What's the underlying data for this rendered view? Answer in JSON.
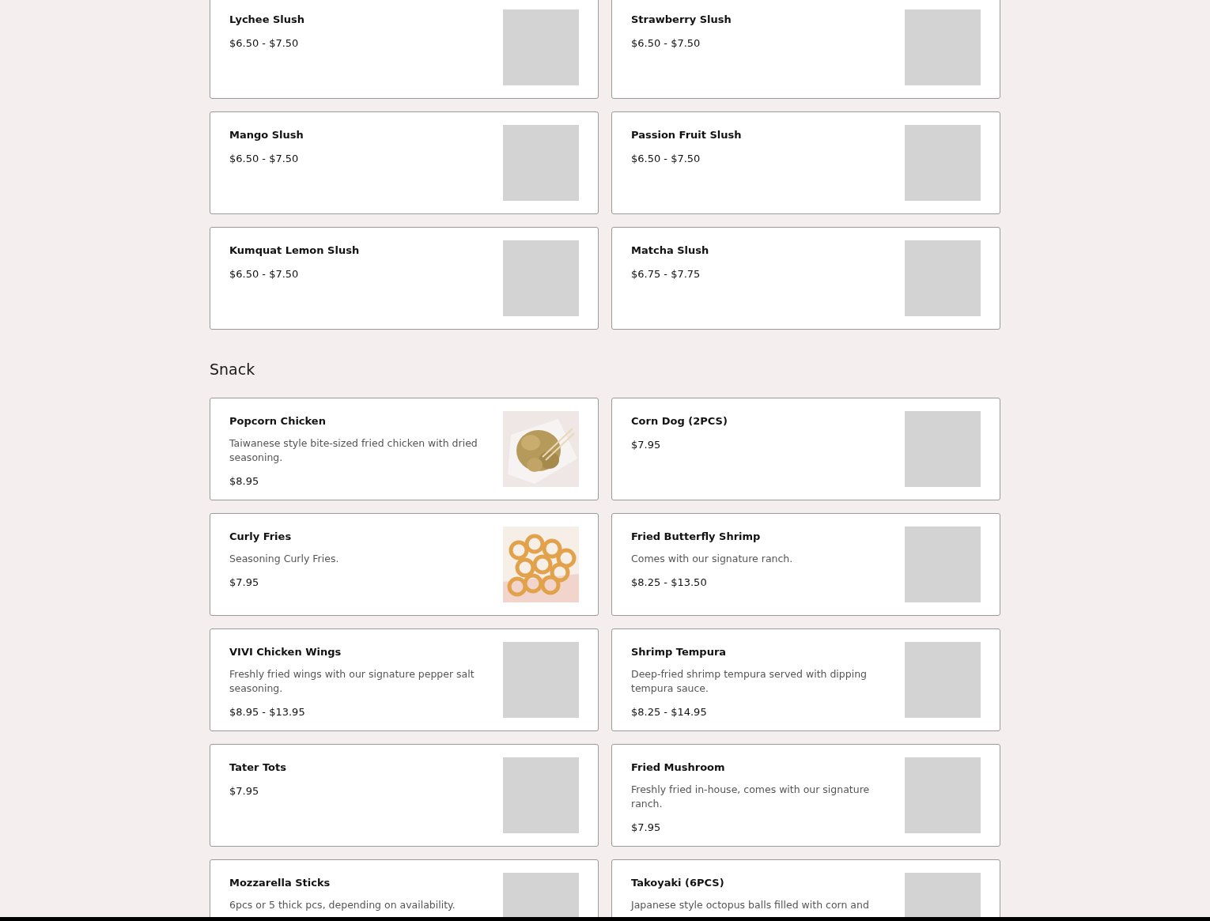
{
  "sections": [
    {
      "items": [
        {
          "name": "Lychee Slush",
          "price": "$6.50 - $7.50",
          "image": {
            "kind": "placeholder"
          }
        },
        {
          "name": "Strawberry Slush",
          "price": "$6.50 - $7.50",
          "image": {
            "kind": "placeholder"
          }
        },
        {
          "name": "Mango Slush",
          "price": "$6.50 - $7.50",
          "image": {
            "kind": "placeholder"
          }
        },
        {
          "name": "Passion Fruit Slush",
          "price": "$6.50 - $7.50",
          "image": {
            "kind": "placeholder"
          }
        },
        {
          "name": "Kumquat Lemon Slush",
          "price": "$6.50 - $7.50",
          "image": {
            "kind": "placeholder"
          }
        },
        {
          "name": "Matcha Slush",
          "price": "$6.75 - $7.75",
          "image": {
            "kind": "placeholder"
          }
        }
      ]
    },
    {
      "title": "Snack",
      "items": [
        {
          "name": "Popcorn Chicken",
          "description": "Taiwanese style bite-sized fried chicken with dried seasoning.",
          "price": "$8.95"
        },
        {
          "name": "Corn Dog (2PCS)",
          "price": "$7.95",
          "image": {
            "kind": "placeholder"
          }
        },
        {
          "name": "Curly Fries",
          "description": "Seasoning Curly Fries.",
          "price": "$7.95"
        },
        {
          "name": "Fried Butterfly Shrimp",
          "description": "Comes with our signature ranch.",
          "price": "$8.25 - $13.50",
          "image": {
            "kind": "placeholder"
          }
        },
        {
          "name": "VIVI Chicken Wings",
          "description": "Freshly fried wings with our signature pepper salt seasoning.",
          "price": "$8.95 - $13.95",
          "image": {
            "kind": "placeholder"
          }
        },
        {
          "name": "Shrimp Tempura",
          "description": "Deep-fried shrimp tempura served with dipping tempura sauce.",
          "price": "$8.25 - $14.95",
          "image": {
            "kind": "placeholder"
          }
        },
        {
          "name": "Tater Tots",
          "price": "$7.95",
          "image": {
            "kind": "placeholder"
          }
        },
        {
          "name": "Fried Mushroom",
          "description": "Freshly fried in-house, comes with our signature ranch.",
          "price": "$7.95",
          "image": {
            "kind": "placeholder"
          }
        },
        {
          "name": "Mozzarella Sticks",
          "description": "6pcs or 5 thick pcs, depending on availability.",
          "image": {
            "kind": "placeholder"
          }
        },
        {
          "name": "Takoyaki (6PCS)",
          "description": "Japanese style octopus balls filled with corn and",
          "image": {
            "kind": "placeholder"
          }
        }
      ]
    }
  ]
}
